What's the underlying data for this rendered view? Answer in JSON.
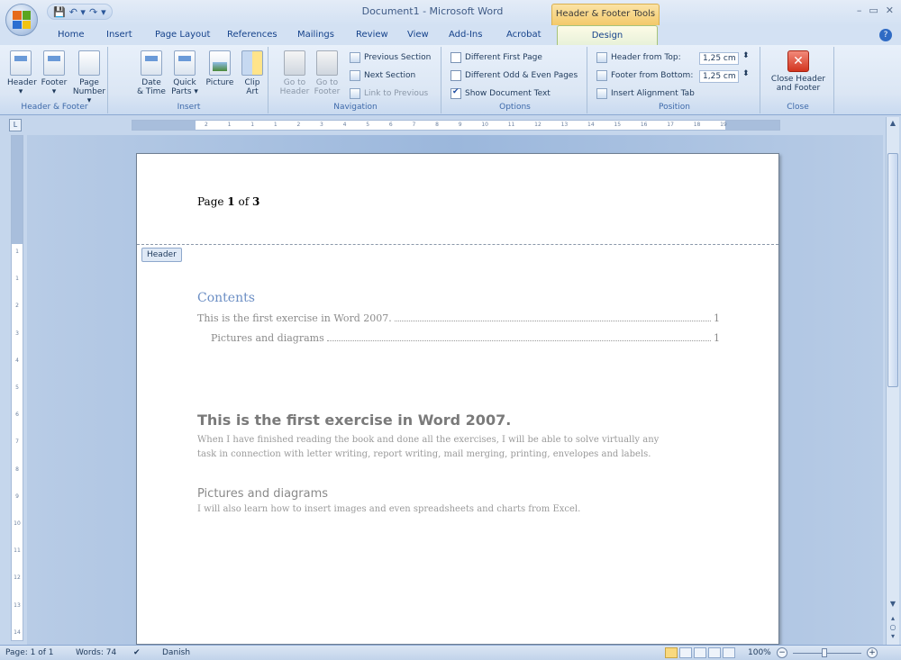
{
  "window": {
    "title": "Document1 - Microsoft Word",
    "contextual_tab_group": "Header & Footer Tools",
    "controls": [
      "–",
      "▭",
      "✕"
    ]
  },
  "quick_access": [
    "💾",
    "↶ ▾",
    "↷",
    "▾"
  ],
  "tabs": [
    "Home",
    "Insert",
    "Page Layout",
    "References",
    "Mailings",
    "Review",
    "View",
    "Add-Ins",
    "Acrobat",
    "Design"
  ],
  "active_tab": "Design",
  "ribbon": {
    "header_footer": {
      "label": "Header & Footer",
      "header": "Header",
      "footer": "Footer",
      "page_number_1": "Page",
      "page_number_2": "Number ▾",
      "header_arrow": "▾",
      "footer_arrow": "▾"
    },
    "insert": {
      "label": "Insert",
      "date_time_1": "Date",
      "date_time_2": "& Time",
      "quick_parts_1": "Quick",
      "quick_parts_2": "Parts ▾",
      "picture": "Picture",
      "clip_art_1": "Clip",
      "clip_art_2": "Art"
    },
    "navigation": {
      "label": "Navigation",
      "goto_header_1": "Go to",
      "goto_header_2": "Header",
      "goto_footer_1": "Go to",
      "goto_footer_2": "Footer",
      "previous_section": "Previous Section",
      "next_section": "Next Section",
      "link_to_previous": "Link to Previous"
    },
    "options": {
      "label": "Options",
      "different_first_page": "Different First Page",
      "different_odd_even": "Different Odd & Even Pages",
      "show_document_text": "Show Document Text"
    },
    "position": {
      "label": "Position",
      "header_from_top": "Header from Top:",
      "header_from_top_value": "1,25 cm",
      "footer_from_bottom": "Footer from Bottom:",
      "footer_from_bottom_value": "1,25 cm",
      "insert_alignment_tab": "Insert Alignment Tab"
    },
    "close": {
      "label": "Close",
      "close_1": "Close Header",
      "close_2": "and Footer"
    }
  },
  "ruler": {
    "horizontal": [
      "2",
      "1",
      "1",
      "1",
      "2",
      "3",
      "4",
      "5",
      "6",
      "7",
      "8",
      "9",
      "10",
      "11",
      "12",
      "13",
      "14",
      "15",
      "16",
      "17",
      "18",
      "19"
    ],
    "vertical": [
      "1",
      "1",
      "2",
      "3",
      "4",
      "5",
      "6",
      "7",
      "8",
      "9",
      "10",
      "11",
      "12",
      "13",
      "14"
    ]
  },
  "document": {
    "header_prefix": "Page ",
    "header_page": "1",
    "header_mid": " of ",
    "header_total": "3",
    "header_tag": "Header",
    "toc_title": "Contents",
    "toc": [
      {
        "text": "This is the first exercise in Word 2007.",
        "page": "1"
      },
      {
        "text": "Pictures and diagrams",
        "page": "1"
      }
    ],
    "heading1": "This is the first exercise in Word 2007.",
    "para1_line1": "When I have finished reading the book and done all the exercises, I will be able to solve virtually any",
    "para1_line2": "task in connection with letter writing, report writing, mail merging, printing, envelopes and labels.",
    "heading2": "Pictures and diagrams",
    "para2": "I will also learn how to insert images and even spreadsheets and charts from Excel."
  },
  "statusbar": {
    "page": "Page: 1 of 1",
    "words": "Words: 74",
    "language": "Danish",
    "zoom": "100%"
  }
}
